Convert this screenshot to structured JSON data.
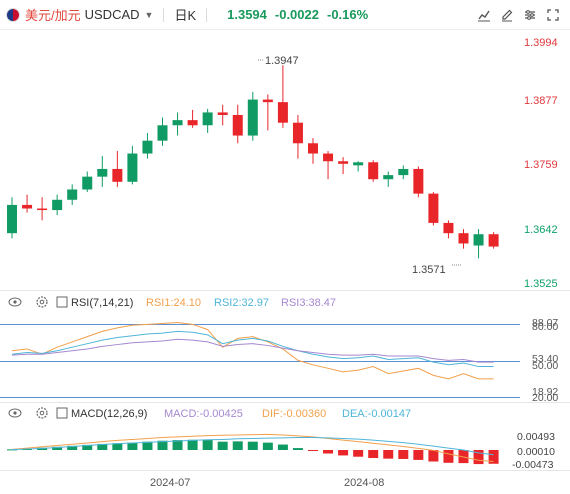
{
  "header": {
    "symbol_cn": "美元/加元",
    "symbol_en": "USDCAD",
    "interval": "日K",
    "price": "1.3594",
    "change": "-0.0022",
    "change_pct": "-0.16%"
  },
  "toolbar_icons": [
    "indicator-icon",
    "edit-icon",
    "settings-icon",
    "fullscreen-icon"
  ],
  "colors": {
    "up": "#109b64",
    "down": "#e8262a",
    "ma_orange": "#f2a04b",
    "ma_blue": "#4fb5d8",
    "ma_purple": "#a688d0",
    "rsi_line": "#5a8fd8"
  },
  "chart_data": {
    "type": "candlestick",
    "ylim": [
      1.3525,
      1.3994
    ],
    "y_ticks": [
      "1.3994",
      "1.3877",
      "1.3759",
      "1.3642",
      "1.3525"
    ],
    "x_ticks": [
      "2024-07",
      "2024-08"
    ],
    "annotations": {
      "high": "1.3947",
      "low": "1.3571"
    },
    "candles": [
      {
        "o": 1.362,
        "h": 1.369,
        "l": 1.361,
        "c": 1.3675
      },
      {
        "o": 1.3675,
        "h": 1.3695,
        "l": 1.366,
        "c": 1.3668
      },
      {
        "o": 1.3668,
        "h": 1.369,
        "l": 1.3645,
        "c": 1.3665
      },
      {
        "o": 1.3665,
        "h": 1.3695,
        "l": 1.3655,
        "c": 1.3685
      },
      {
        "o": 1.3685,
        "h": 1.3715,
        "l": 1.3675,
        "c": 1.3705
      },
      {
        "o": 1.3705,
        "h": 1.374,
        "l": 1.37,
        "c": 1.373
      },
      {
        "o": 1.373,
        "h": 1.377,
        "l": 1.371,
        "c": 1.3745
      },
      {
        "o": 1.3745,
        "h": 1.378,
        "l": 1.371,
        "c": 1.372
      },
      {
        "o": 1.372,
        "h": 1.379,
        "l": 1.3715,
        "c": 1.3775
      },
      {
        "o": 1.3775,
        "h": 1.3815,
        "l": 1.3765,
        "c": 1.38
      },
      {
        "o": 1.38,
        "h": 1.3845,
        "l": 1.379,
        "c": 1.383
      },
      {
        "o": 1.383,
        "h": 1.3855,
        "l": 1.381,
        "c": 1.384
      },
      {
        "o": 1.384,
        "h": 1.386,
        "l": 1.3825,
        "c": 1.383
      },
      {
        "o": 1.383,
        "h": 1.3862,
        "l": 1.3815,
        "c": 1.3855
      },
      {
        "o": 1.3855,
        "h": 1.387,
        "l": 1.383,
        "c": 1.385
      },
      {
        "o": 1.385,
        "h": 1.387,
        "l": 1.3795,
        "c": 1.381
      },
      {
        "o": 1.381,
        "h": 1.3895,
        "l": 1.38,
        "c": 1.388
      },
      {
        "o": 1.388,
        "h": 1.389,
        "l": 1.382,
        "c": 1.3875
      },
      {
        "o": 1.3875,
        "h": 1.3947,
        "l": 1.3825,
        "c": 1.3835
      },
      {
        "o": 1.3835,
        "h": 1.385,
        "l": 1.3765,
        "c": 1.3795
      },
      {
        "o": 1.3795,
        "h": 1.3805,
        "l": 1.3755,
        "c": 1.3775
      },
      {
        "o": 1.3775,
        "h": 1.378,
        "l": 1.3725,
        "c": 1.376
      },
      {
        "o": 1.376,
        "h": 1.3768,
        "l": 1.3735,
        "c": 1.3755
      },
      {
        "o": 1.3752,
        "h": 1.376,
        "l": 1.374,
        "c": 1.3758
      },
      {
        "o": 1.3758,
        "h": 1.3762,
        "l": 1.372,
        "c": 1.3725
      },
      {
        "o": 1.3725,
        "h": 1.374,
        "l": 1.371,
        "c": 1.3733
      },
      {
        "o": 1.3733,
        "h": 1.3752,
        "l": 1.3725,
        "c": 1.3745
      },
      {
        "o": 1.3745,
        "h": 1.375,
        "l": 1.369,
        "c": 1.3697
      },
      {
        "o": 1.3697,
        "h": 1.37,
        "l": 1.3635,
        "c": 1.364
      },
      {
        "o": 1.364,
        "h": 1.3645,
        "l": 1.361,
        "c": 1.362
      },
      {
        "o": 1.362,
        "h": 1.3628,
        "l": 1.359,
        "c": 1.36
      },
      {
        "o": 1.3596,
        "h": 1.3628,
        "l": 1.3571,
        "c": 1.3618
      },
      {
        "o": 1.3618,
        "h": 1.3622,
        "l": 1.359,
        "c": 1.3594
      }
    ]
  },
  "rsi": {
    "label": "RSI(7,14,21)",
    "rsi1": "RSI1:24.10",
    "rsi2": "RSI2:32.97",
    "rsi3": "RSI3:38.47",
    "levels": [
      "88.07",
      "80.00",
      "53.40",
      "50.00",
      "18.92",
      "20.00"
    ],
    "series_orange": [
      56,
      58,
      52,
      60,
      66,
      72,
      78,
      82,
      85,
      86,
      87,
      88,
      86,
      80,
      60,
      70,
      72,
      66,
      58,
      45,
      40,
      36,
      32,
      34,
      38,
      30,
      33,
      36,
      28,
      24,
      30,
      24,
      24
    ],
    "series_blue": [
      52,
      54,
      53,
      56,
      60,
      64,
      68,
      71,
      73,
      75,
      76,
      78,
      77,
      74,
      64,
      68,
      70,
      67,
      61,
      56,
      52,
      49,
      47,
      48,
      50,
      46,
      47,
      48,
      43,
      40,
      42,
      38,
      38
    ],
    "series_purple": [
      51,
      52,
      52,
      54,
      56,
      58,
      61,
      63,
      65,
      66,
      67,
      69,
      68,
      66,
      61,
      63,
      64,
      62,
      59,
      56,
      54,
      52,
      51,
      51,
      52,
      50,
      50,
      50,
      47,
      45,
      46,
      43,
      43
    ]
  },
  "macd": {
    "label": "MACD(12,26,9)",
    "macd_val": "MACD:-0.00425",
    "dif_val": "DIF:-0.00360",
    "dea_val": "DEA:-0.00147",
    "y_ticks": [
      "0.00493",
      "0.00010",
      "-0.00473"
    ],
    "hist": [
      0.0002,
      0.0004,
      0.0007,
      0.001,
      0.0013,
      0.0016,
      0.0019,
      0.0021,
      0.0023,
      0.0026,
      0.0029,
      0.0031,
      0.0032,
      0.0031,
      0.0026,
      0.0027,
      0.0026,
      0.0023,
      0.0017,
      0.0006,
      -0.0003,
      -0.0011,
      -0.0017,
      -0.0021,
      -0.0025,
      -0.0027,
      -0.0028,
      -0.0031,
      -0.0036,
      -0.004,
      -0.0041,
      -0.0044,
      -0.0043
    ],
    "dif": [
      0.0002,
      0.0006,
      0.001,
      0.0014,
      0.0018,
      0.0022,
      0.0026,
      0.003,
      0.0033,
      0.0036,
      0.0039,
      0.0041,
      0.0043,
      0.0045,
      0.0046,
      0.0047,
      0.0048,
      0.0049,
      0.0047,
      0.0044,
      0.0041,
      0.0036,
      0.0031,
      0.0026,
      0.0021,
      0.0016,
      0.0011,
      0.0005,
      -0.0001,
      -0.0012,
      -0.0022,
      -0.0032,
      -0.0036
    ],
    "dea": [
      0.0001,
      0.0003,
      0.0005,
      0.0008,
      0.0011,
      0.0014,
      0.0017,
      0.002,
      0.0022,
      0.0024,
      0.0026,
      0.0028,
      0.003,
      0.0032,
      0.0033,
      0.0035,
      0.0036,
      0.0037,
      0.0038,
      0.0039,
      0.0039,
      0.0038,
      0.0036,
      0.0034,
      0.0031,
      0.0027,
      0.0023,
      0.0018,
      0.0012,
      0.0006,
      0.0,
      -0.0009,
      -0.0015
    ]
  }
}
